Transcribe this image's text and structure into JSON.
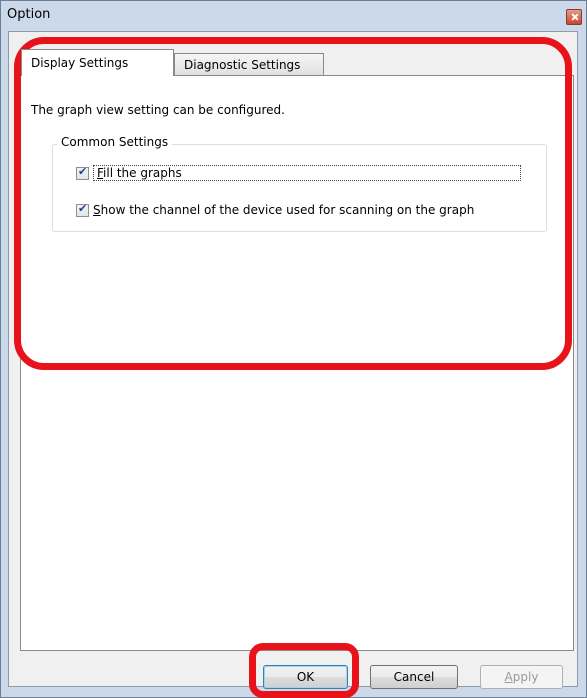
{
  "window": {
    "title": "Option"
  },
  "tabs": [
    {
      "label": "Display Settings",
      "active": true
    },
    {
      "label": "Diagnostic Settings",
      "active": false
    }
  ],
  "display": {
    "description": "The graph view setting can be configured.",
    "group": {
      "title": "Common Settings",
      "options": [
        {
          "label": "Fill the graphs",
          "mnemonic": "F",
          "checked": true
        },
        {
          "label": "Show the channel of the device used for scanning on the graph",
          "mnemonic": "S",
          "checked": true
        }
      ]
    }
  },
  "buttons": {
    "ok": "OK",
    "cancel": "Cancel",
    "apply": "Apply"
  },
  "colors": {
    "highlight": "#e8121b",
    "frame": "#cbd9ea"
  },
  "icons": {
    "close": "close-icon",
    "checkbox": "checkmark-icon"
  }
}
